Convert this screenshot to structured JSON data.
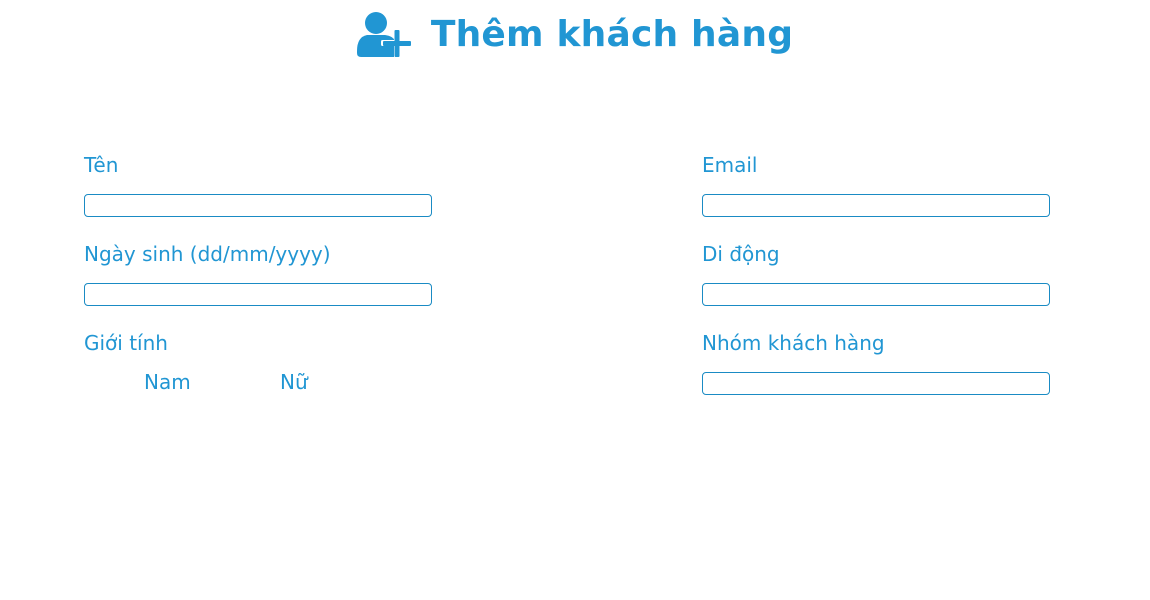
{
  "header": {
    "title": "Thêm khách hàng",
    "icon": "user-plus-icon",
    "accent_color": "#2196d3"
  },
  "form": {
    "name": {
      "label": "Tên",
      "value": "",
      "placeholder": ""
    },
    "birthday": {
      "label": "Ngày sinh (dd/mm/yyyy)",
      "value": "",
      "placeholder": ""
    },
    "gender": {
      "label": "Giới tính",
      "options": [
        "Nam",
        "Nữ"
      ]
    },
    "email": {
      "label": "Email",
      "value": "",
      "placeholder": ""
    },
    "mobile": {
      "label": "Di động",
      "value": "",
      "placeholder": ""
    },
    "customer_group": {
      "label": "Nhóm khách hàng",
      "value": "",
      "placeholder": ""
    }
  }
}
